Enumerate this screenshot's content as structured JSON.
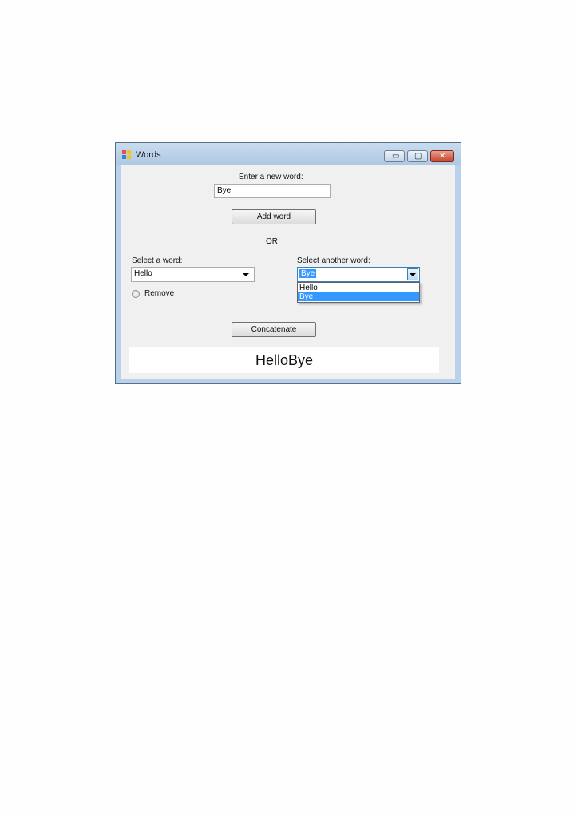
{
  "window": {
    "title": "Words",
    "min_glyph": "▭",
    "max_glyph": "▢",
    "close_glyph": "✕",
    "icon": "app-form-icon"
  },
  "add_section": {
    "label": "Enter a new word:",
    "input_value": "Bye",
    "add_button": "Add word",
    "or_text": "OR"
  },
  "select_section": {
    "left_label": "Select a word:",
    "left_value": "Hello",
    "right_label": "Select another word:",
    "right_value": "Bye",
    "dropdown_options": [
      "Hello",
      "Bye"
    ],
    "dropdown_selected_index": 1
  },
  "remove": {
    "label": "Remove",
    "checked": false
  },
  "concatenate_button": "Concatenate",
  "result": "HelloBye",
  "colors": {
    "selection": "#3399ff",
    "form_background": "#f0f0f0",
    "title_bar": "#b9d1ea"
  }
}
